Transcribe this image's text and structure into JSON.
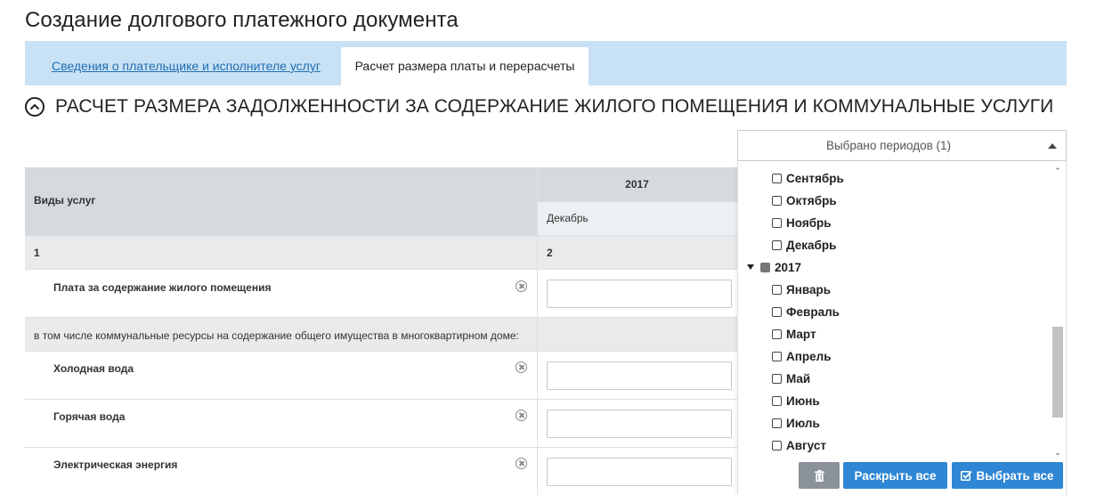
{
  "page": {
    "title": "Создание долгового платежного документа"
  },
  "tabs": [
    {
      "label": "Сведения о плательщике и исполнителе услуг",
      "active": false
    },
    {
      "label": "Расчет размера платы и перерасчеты",
      "active": true
    }
  ],
  "section": {
    "title": "РАСЧЕТ РАЗМЕРА ЗАДОЛЖЕННОСТИ ЗА СОДЕРЖАНИЕ ЖИЛОГО ПОМЕЩЕНИЯ И КОММУНАЛЬНЫЕ УСЛУГИ"
  },
  "table": {
    "header": {
      "services_label": "Виды услуг",
      "year": "2017",
      "month": "Декабрь"
    },
    "column_numbers": [
      "1",
      "2"
    ],
    "rows": [
      {
        "label": "Плата за содержание жилого помещения",
        "value": ""
      }
    ],
    "group_label": "в том числе коммунальные ресурсы на содержание общего имущества в многоквартирном доме:",
    "group_rows": [
      {
        "label": "Холодная вода",
        "value": ""
      },
      {
        "label": "Горячая вода",
        "value": ""
      },
      {
        "label": "Электрическая энергия",
        "value": ""
      }
    ]
  },
  "period_select": {
    "selected_text": "Выбрано периодов (1)",
    "months_before": [
      "Сентябрь",
      "Октябрь",
      "Ноябрь",
      "Декабрь"
    ],
    "year": "2017",
    "months_2017": [
      "Январь",
      "Февраль",
      "Март",
      "Апрель",
      "Май",
      "Июнь",
      "Июль",
      "Август"
    ],
    "buttons": {
      "expand_all": "Раскрыть все",
      "select_all": "Выбрать все"
    }
  },
  "colors": {
    "tabbar_bg": "#c9e1f5",
    "link": "#1f6fb2",
    "table_header_bg": "#d5dadf",
    "primary_button": "#2f86d4",
    "trash_button": "#8a9199"
  },
  "icons": [
    "chevron-up-circle-icon",
    "remove-circle-icon",
    "caret-up-icon",
    "caret-down-icon",
    "trash-icon",
    "checkbox-checked-icon"
  ]
}
